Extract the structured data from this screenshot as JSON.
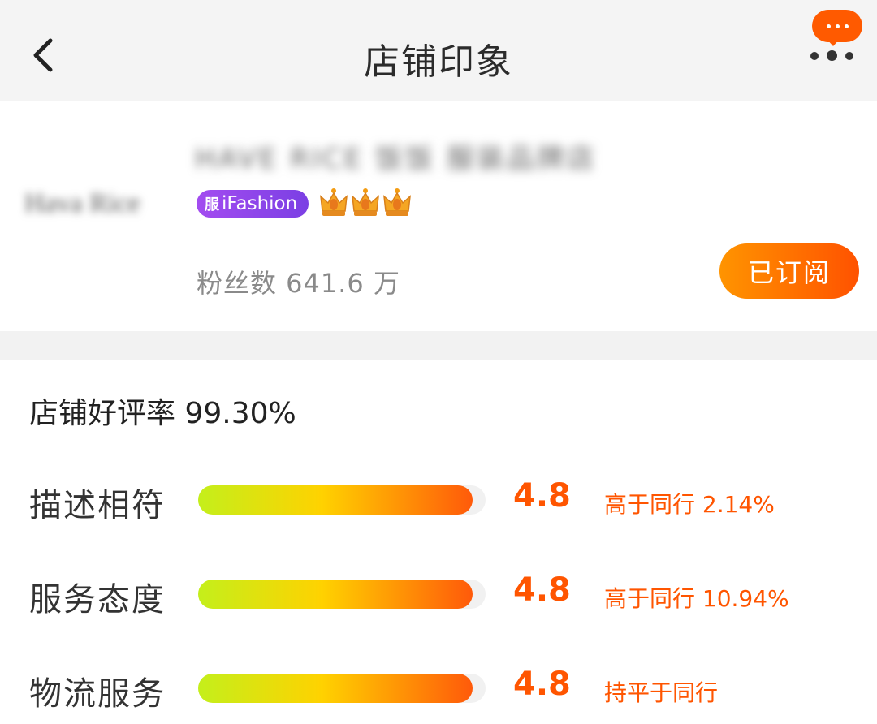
{
  "header": {
    "title": "店铺印象"
  },
  "store": {
    "logo_text": "Hava Rice",
    "name": "HAVE RICE 饭饭 服装品牌店",
    "badge": "iFashion",
    "badge_icon": "服",
    "crown_count": 3,
    "fans": "粉丝数 641.6 万",
    "subscribe_label": "已订阅"
  },
  "ratings": {
    "good_rate": "店铺好评率 99.30%",
    "max_score": 5,
    "items": [
      {
        "label": "描述相符",
        "score": "4.8",
        "score_value": 4.8,
        "compare": "高于同行 2.14%"
      },
      {
        "label": "服务态度",
        "score": "4.8",
        "score_value": 4.8,
        "compare": "高于同行 10.94%"
      },
      {
        "label": "物流服务",
        "score": "4.8",
        "score_value": 4.8,
        "compare": "持平于同行"
      }
    ]
  },
  "colors": {
    "accent": "#ff5500",
    "badge_purple": "#8e44ec",
    "crown_gold": "#f5a623"
  }
}
